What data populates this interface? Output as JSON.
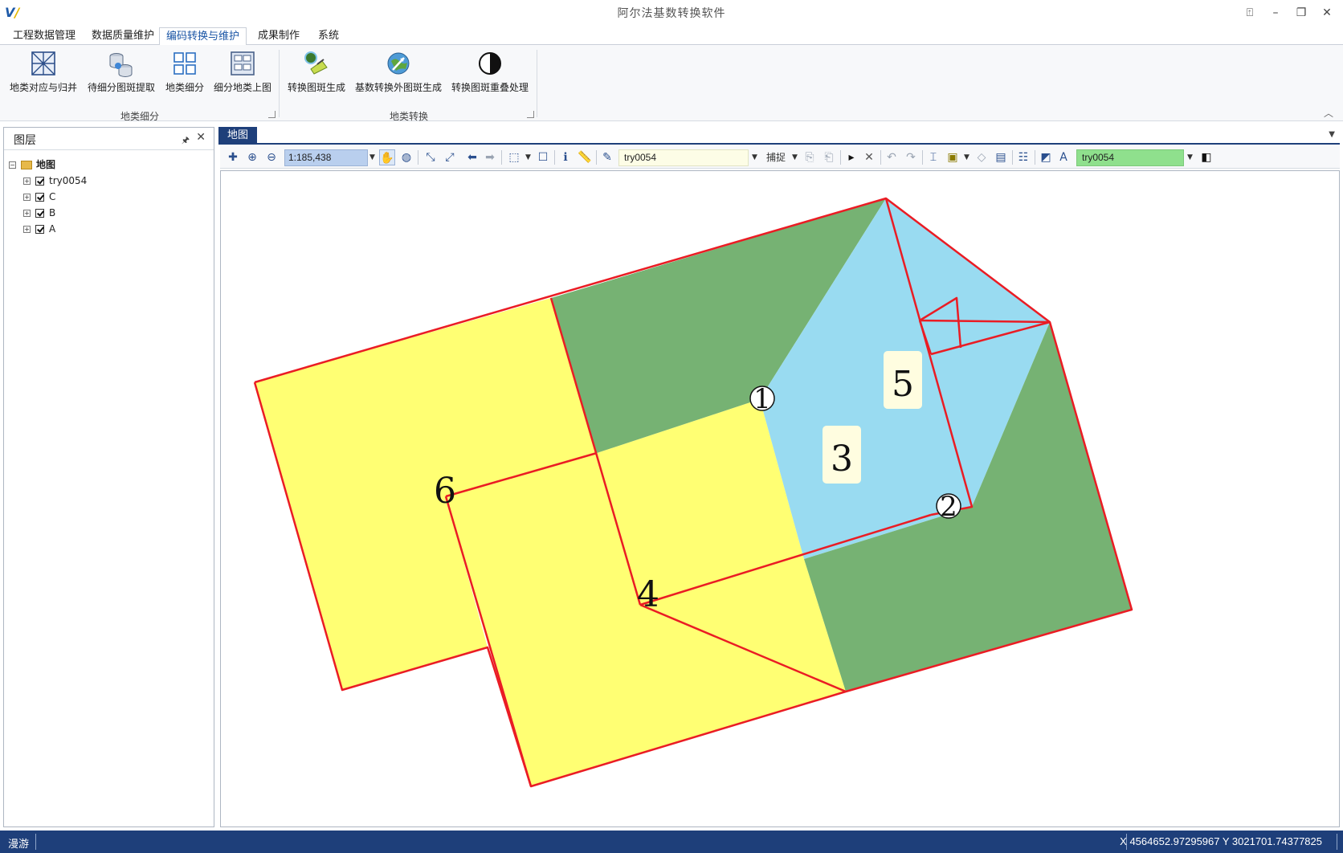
{
  "window": {
    "title": "阿尔法基数转换软件",
    "controls": [
      "⍐",
      "–",
      "❐",
      "✕"
    ]
  },
  "ribbon": {
    "tabs": [
      {
        "label": "工程数据管理"
      },
      {
        "label": "数据质量维护"
      },
      {
        "label": "编码转换与维护",
        "active": true
      },
      {
        "label": "成果制作"
      },
      {
        "label": "系统"
      }
    ],
    "groups": [
      {
        "label": "地类细分",
        "buttons": [
          "地类对应与归并",
          "待细分图斑提取",
          "地类细分",
          "细分地类上图"
        ]
      },
      {
        "label": "地类转换",
        "buttons": [
          "转换图斑生成",
          "基数转换外图斑生成",
          "转换图斑重叠处理"
        ]
      }
    ]
  },
  "layer_panel": {
    "title": "图层",
    "root": "地图",
    "layers": [
      "try0054",
      "C",
      "B",
      "A"
    ]
  },
  "map": {
    "tab": "地图",
    "scale": "1:185,438",
    "edit_layer": "try0054",
    "snap_label": "捕捉",
    "target_layer": "try0054",
    "labels": [
      "1",
      "2",
      "3",
      "4",
      "5",
      "6"
    ],
    "colors": {
      "yellow": "#ffff73",
      "green": "#76b273",
      "blue": "#99dbf1",
      "border": "#ea1c24"
    }
  },
  "status": {
    "mode": "漫游",
    "coords": "X 4564652.97295967  Y 3021701.74377825"
  }
}
